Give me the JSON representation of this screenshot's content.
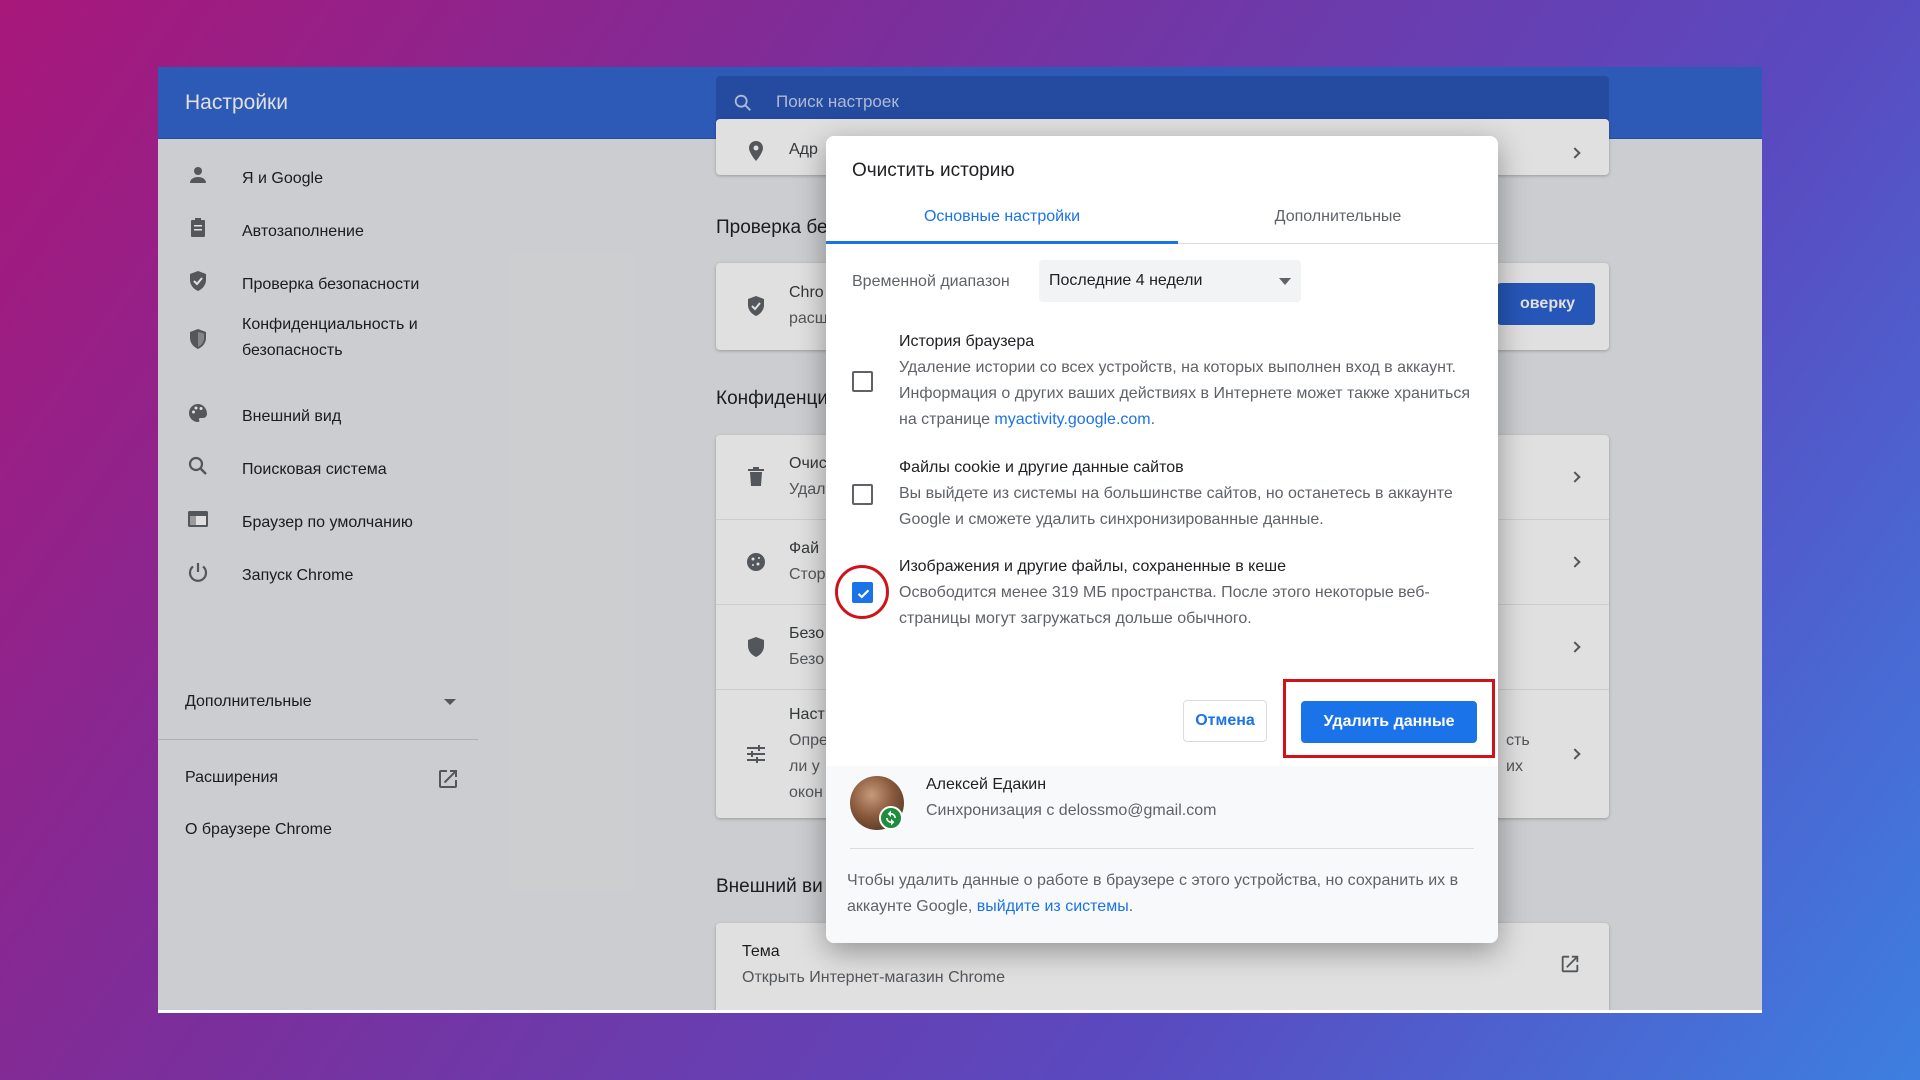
{
  "app": {
    "title": "Настройки"
  },
  "search": {
    "placeholder": "Поиск настроек"
  },
  "sidebar": {
    "items": [
      {
        "label": "Я и Google",
        "icon": "person-icon"
      },
      {
        "label": "Автозаполнение",
        "icon": "clipboard-icon"
      },
      {
        "label": "Проверка безопасности",
        "icon": "shield-check-icon"
      },
      {
        "label": "Конфиденциальность и безопасность",
        "icon": "shield-icon"
      },
      {
        "label": "Внешний вид",
        "icon": "palette-icon"
      },
      {
        "label": "Поисковая система",
        "icon": "search-icon"
      },
      {
        "label": "Браузер по умолчанию",
        "icon": "browser-icon"
      },
      {
        "label": "Запуск Chrome",
        "icon": "power-icon"
      }
    ],
    "advanced": "Дополнительные",
    "extensions": "Расширения",
    "about": "О браузере Chrome"
  },
  "content": {
    "top_partial": "Адр",
    "safety_title": "Проверка бе",
    "safety_row_1": "Chro",
    "safety_row_2": "расш",
    "safety_button": "оверку",
    "privacy_title": "Конфиденци",
    "privacy_rows": [
      {
        "line1": "Очис",
        "line2": "Удал"
      },
      {
        "line1": "Фай",
        "line2": "Стор"
      },
      {
        "line1": "Безо",
        "line2": "Безо"
      },
      {
        "line1": "Наст",
        "line2": "Опре",
        "line3": "ли у",
        "line4": "окон"
      }
    ],
    "privacy_right_1": "сть",
    "privacy_right_2": "их",
    "appearance_title": "Внешний ви",
    "theme_title": "Тема",
    "theme_sub": "Открыть Интернет-магазин Chrome"
  },
  "dialog": {
    "title": "Очистить историю",
    "tabs": [
      "Основные настройки",
      "Дополнительные"
    ],
    "range_label": "Временной диапазон",
    "range_value": "Последние 4 недели",
    "items": [
      {
        "title": "История браузера",
        "desc_pre": "Удаление истории со всех устройств, на которых выполнен вход в аккаунт. Информация о других ваших действиях в Интернете может также храниться на странице ",
        "desc_link": "myactivity.google.com",
        "desc_post": ".",
        "checked": false
      },
      {
        "title": "Файлы cookie и другие данные сайтов",
        "desc": "Вы выйдете из системы на большинстве сайтов, но останетесь в аккаунте Google и сможете удалить синхронизированные данные.",
        "checked": false
      },
      {
        "title": "Изображения и другие файлы, сохраненные в кеше",
        "desc": "Освободится менее 319 МБ пространства. После этого некоторые веб-страницы могут загружаться дольше обычного.",
        "checked": true
      }
    ],
    "cancel": "Отмена",
    "delete": "Удалить данные",
    "account": {
      "name": "Алексей Едакин",
      "sync": "Синхронизация с delossmo@gmail.com"
    },
    "note_pre": "Чтобы удалить данные о работе в браузере с этого устройства, но сохранить их в аккаунте Google, ",
    "note_link": "выйдите из системы",
    "note_post": "."
  },
  "colors": {
    "accent": "#1a73e8",
    "header": "#3567d1",
    "highlight": "#d0121b"
  }
}
